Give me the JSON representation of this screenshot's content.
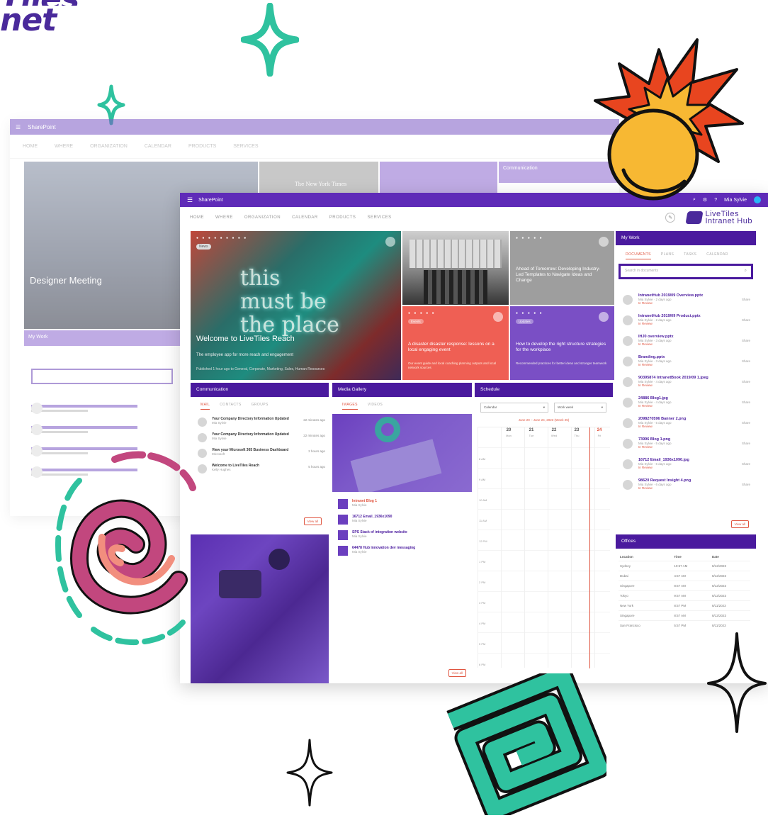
{
  "brand": {
    "line1": "Tiles",
    "line2": "net"
  },
  "back_window": {
    "topbar_title": "SharePoint",
    "nav": [
      "HOME",
      "WHERE",
      "ORGANIZATION",
      "CALENDAR",
      "PRODUCTS",
      "SERVICES"
    ],
    "hero_caption": "Designer Meeting",
    "tile2_title": "The New York Times",
    "side_title": "Communication",
    "mylinks_title": "My Work"
  },
  "window": {
    "topbar_title": "SharePoint",
    "user": "Mia Sylvie",
    "nav": [
      "HOME",
      "WHERE",
      "ORGANIZATION",
      "CALENDAR",
      "PRODUCTS",
      "SERVICES"
    ],
    "logo_line1": "LiveTiles",
    "logo_line2": "Intranet Hub"
  },
  "hero": {
    "neon": [
      "this",
      "must be",
      "the place"
    ],
    "caption": "Welcome to LiveTiles Reach",
    "subtitle": "The employee app for more reach and engagement",
    "meta": "Published 1 hour ago to General, Corporate, Marketing, Sales, Human Resources",
    "tag": "News"
  },
  "tiles": {
    "grey_text": "Ahead of Tomorrow: Developing Industry-Led Templates to Navigate Ideas and Change",
    "coral_pill": "Events",
    "coral_text": "A disaster disaster response: lessons on a local engaging event",
    "coral_sub": "Our event guide and local coaching planning outputs and local network sources",
    "purple_pill": "Updates",
    "purple_text": "How to develop the right structure strategies for the workplace",
    "purple_sub": "Recommended practices for better ideas and stronger teamwork"
  },
  "mywork": {
    "title": "My Work",
    "tabs": [
      "DOCUMENTS",
      "PLANS",
      "TASKS",
      "CALENDAR"
    ],
    "search_placeholder": "Search in documents",
    "items": [
      {
        "name": "IntranetHub 2019/09 Overview.pptx",
        "by": "Mia Sylvie · 2 days ago",
        "status": "In Review",
        "action": "Share"
      },
      {
        "name": "IntranetHub 2019/09 Product.pptx",
        "by": "Mia Sylvie · 2 days ago",
        "status": "In Review",
        "action": "Share"
      },
      {
        "name": "IHJ0 overview.pptx",
        "by": "Mia Sylvie · 3 days ago",
        "status": "In Review",
        "action": "Share"
      },
      {
        "name": "Branding.pptx",
        "by": "Mia Sylvie · 3 days ago",
        "status": "In Review",
        "action": "Share"
      },
      {
        "name": "90395874 IntranetBook 2019/09 1.jpeg",
        "by": "Mia Sylvie · 4 days ago",
        "status": "In Review",
        "action": "Share"
      },
      {
        "name": "24886 Blog1.jpg",
        "by": "Mia Sylvie · 4 days ago",
        "status": "In Review",
        "action": "Share"
      },
      {
        "name": "2098270596 Banner 2.png",
        "by": "Mia Sylvie · 5 days ago",
        "status": "In Review",
        "action": "Share"
      },
      {
        "name": "73996 Blog 1.png",
        "by": "Mia Sylvie · 5 days ago",
        "status": "In Review",
        "action": "Share"
      },
      {
        "name": "16712 Email_1936x1090.jpg",
        "by": "Mia Sylvie · 6 days ago",
        "status": "In Review",
        "action": "Share"
      },
      {
        "name": "98620 Request Insight 4.png",
        "by": "Mia Sylvie · 6 days ago",
        "status": "In Review",
        "action": "Share"
      }
    ],
    "view_all": "View all"
  },
  "offices": {
    "title": "Offices",
    "headers": [
      "Location",
      "Time",
      "Date"
    ],
    "rows": [
      [
        "Sydney",
        "10:57 AM",
        "8/12/2023"
      ],
      [
        "Dubai",
        "4:57 AM",
        "8/12/2023"
      ],
      [
        "Singapore",
        "8:57 AM",
        "8/12/2023"
      ],
      [
        "Tokyo",
        "9:57 AM",
        "8/12/2023"
      ],
      [
        "New York",
        "8:57 PM",
        "8/11/2023"
      ],
      [
        "Singapore",
        "8:57 AM",
        "8/12/2023"
      ],
      [
        "San Francisco",
        "5:57 PM",
        "8/11/2023"
      ]
    ]
  },
  "communication": {
    "title": "Communication",
    "tabs": [
      "MAIL",
      "CONTACTS",
      "GROUPS"
    ],
    "items": [
      {
        "name": "Your Company Directory Information Updated",
        "by": "Mia Sylvie",
        "time": "22 minutes ago"
      },
      {
        "name": "Your Company Directory Information Updated",
        "by": "Mia Sylvie",
        "time": "22 minutes ago"
      },
      {
        "name": "View your Microsoft 365 Business Dashboard",
        "by": "Microsoft",
        "time": "2 hours ago"
      },
      {
        "name": "Welcome to LiveTiles Reach",
        "by": "Kelly Hughes",
        "time": "5 hours ago"
      }
    ],
    "view_all": "View all"
  },
  "media": {
    "title": "Media Gallery",
    "tabs": [
      "IMAGES",
      "VIDEOS"
    ],
    "items": [
      {
        "name": "Intranet Blog 1",
        "by": "Mia Sylvie"
      },
      {
        "name": "16712 Email_1936x1090",
        "by": "Mia Sylvie"
      },
      {
        "name": "SPS Stack of integration website",
        "by": "Mia Sylvie"
      },
      {
        "name": "64478 Hub innovation dev messaging",
        "by": "Mia Sylvie"
      }
    ],
    "view_all": "View all"
  },
  "schedule": {
    "title": "Schedule",
    "select1": "Calendar",
    "select2": "Work week",
    "range": "June 20 – June 24, 2023 (Week 25)",
    "days": [
      {
        "num": "20",
        "name": "Mon"
      },
      {
        "num": "21",
        "name": "Tue"
      },
      {
        "num": "22",
        "name": "Wed"
      },
      {
        "num": "23",
        "name": "Thu"
      },
      {
        "num": "24",
        "name": "Fri"
      }
    ],
    "hours": [
      "8 AM",
      "9 AM",
      "10 AM",
      "11 AM",
      "12 PM",
      "1 PM",
      "2 PM",
      "3 PM",
      "4 PM",
      "5 PM",
      "6 PM"
    ]
  },
  "colors": {
    "primary": "#4a1a9e",
    "accent": "#e0543f",
    "topbar": "#5f2bb8",
    "teal": "#2fc29f"
  }
}
